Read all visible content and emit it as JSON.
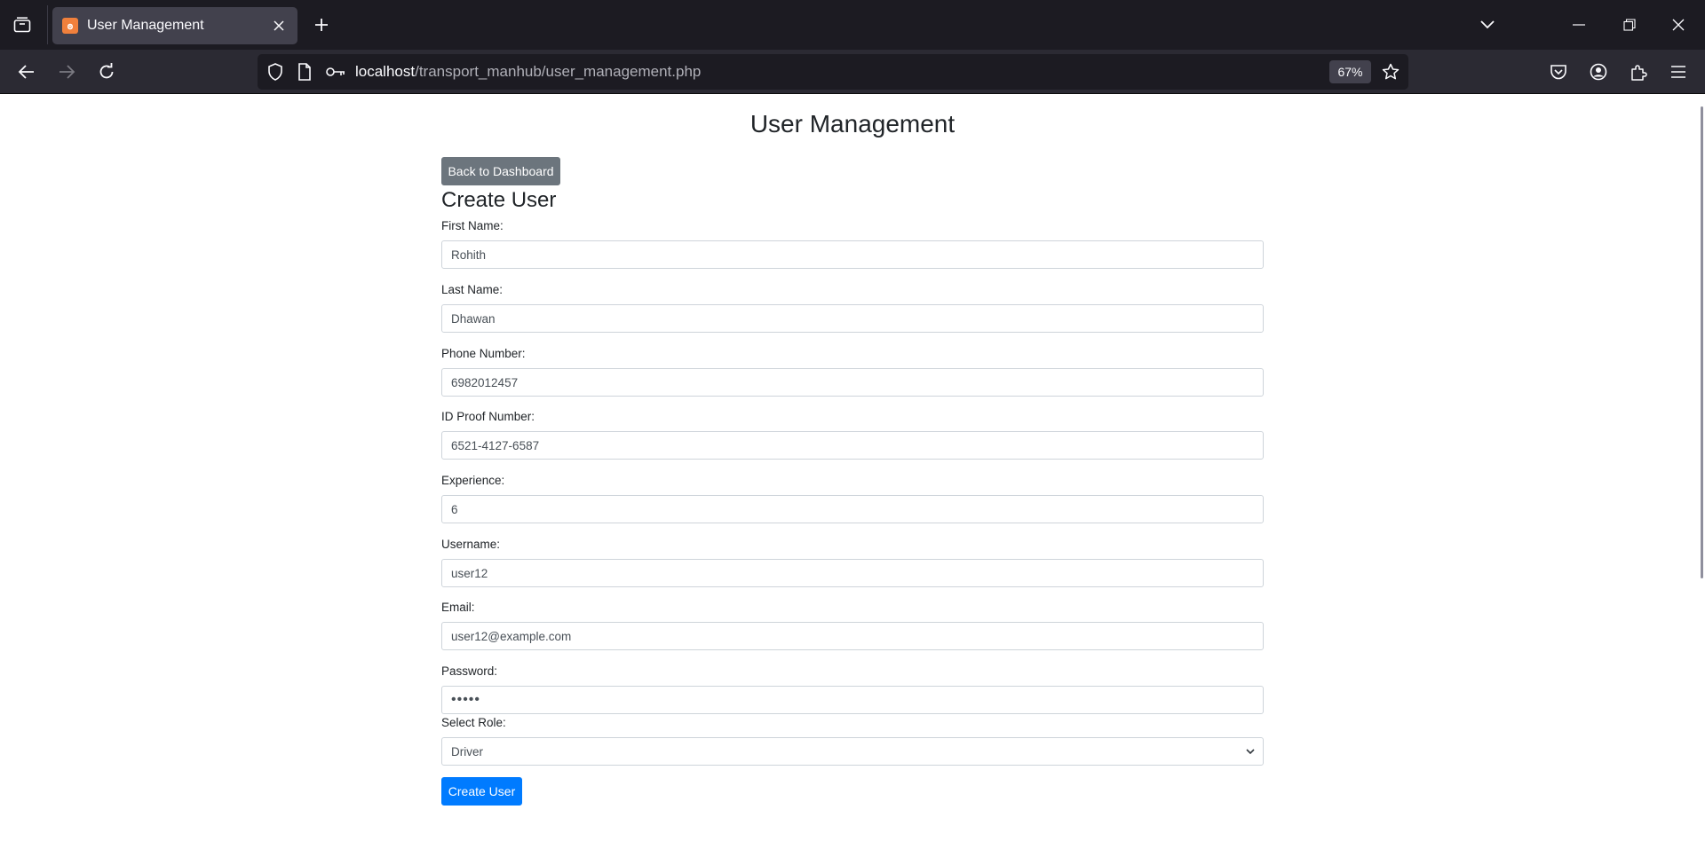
{
  "browser": {
    "tab_title": "User Management",
    "url_host": "localhost",
    "url_path": "/transport_manhub/user_management.php",
    "zoom": "67%"
  },
  "page": {
    "title": "User Management",
    "back_button": "Back to Dashboard",
    "section_title": "Create User",
    "fields": {
      "first_name": {
        "label": "First Name:",
        "value": "Rohith"
      },
      "last_name": {
        "label": "Last Name:",
        "value": "Dhawan"
      },
      "phone": {
        "label": "Phone Number:",
        "value": "6982012457"
      },
      "id_proof": {
        "label": "ID Proof Number:",
        "value": "6521-4127-6587"
      },
      "experience": {
        "label": "Experience:",
        "value": "6"
      },
      "username": {
        "label": "Username:",
        "value": "user12"
      },
      "email": {
        "label": "Email:",
        "value": "user12@example.com"
      },
      "password": {
        "label": "Password:",
        "value": "•••••"
      },
      "role": {
        "label": "Select Role:",
        "value": "Driver"
      }
    },
    "submit_button": "Create User"
  },
  "colors": {
    "primary": "#007bff",
    "secondary": "#6c757d",
    "favicon": "#f0803c"
  }
}
